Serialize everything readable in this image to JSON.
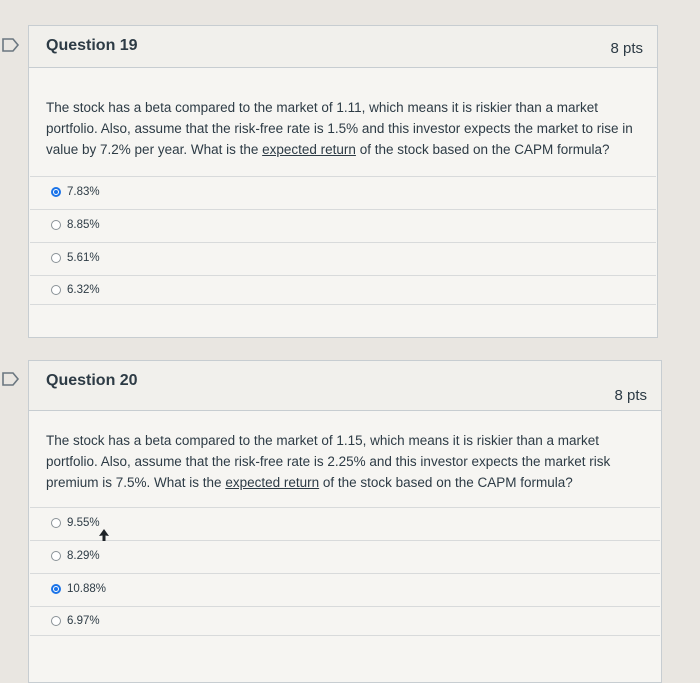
{
  "questions": [
    {
      "title": "Question 19",
      "points": "8 pts",
      "text_before": "The stock has a beta compared to the market of 1.11, which means it is riskier than a market portfolio. Also, assume that the risk-free rate is 1.5% and this investor expects the market to rise in value by 7.2% per year. What is the ",
      "text_link": "expected return",
      "text_after": " of the stock based on the CAPM formula?",
      "answers": [
        {
          "label": "7.83%",
          "selected": true
        },
        {
          "label": "8.85%",
          "selected": false
        },
        {
          "label": "5.61%",
          "selected": false
        },
        {
          "label": "6.32%",
          "selected": false
        }
      ]
    },
    {
      "title": "Question 20",
      "points": "8 pts",
      "text_before": "The stock has a beta compared to the market of 1.15, which means it is riskier than a market portfolio. Also, assume that the risk-free rate is 2.25% and this investor expects the market risk premium is 7.5%. What is the ",
      "text_link": "expected return",
      "text_after": " of the stock based on the CAPM formula?",
      "answers": [
        {
          "label": "9.55%",
          "selected": false
        },
        {
          "label": "8.29%",
          "selected": false
        },
        {
          "label": "10.88%",
          "selected": true
        },
        {
          "label": "6.97%",
          "selected": false
        }
      ]
    }
  ],
  "colors": {
    "selected_radio": "#1a73e8",
    "flag_outline": "#6b7780"
  },
  "icons": {
    "flag": "flag-bookmark-icon",
    "cursor": "mouse-pointer-icon"
  }
}
